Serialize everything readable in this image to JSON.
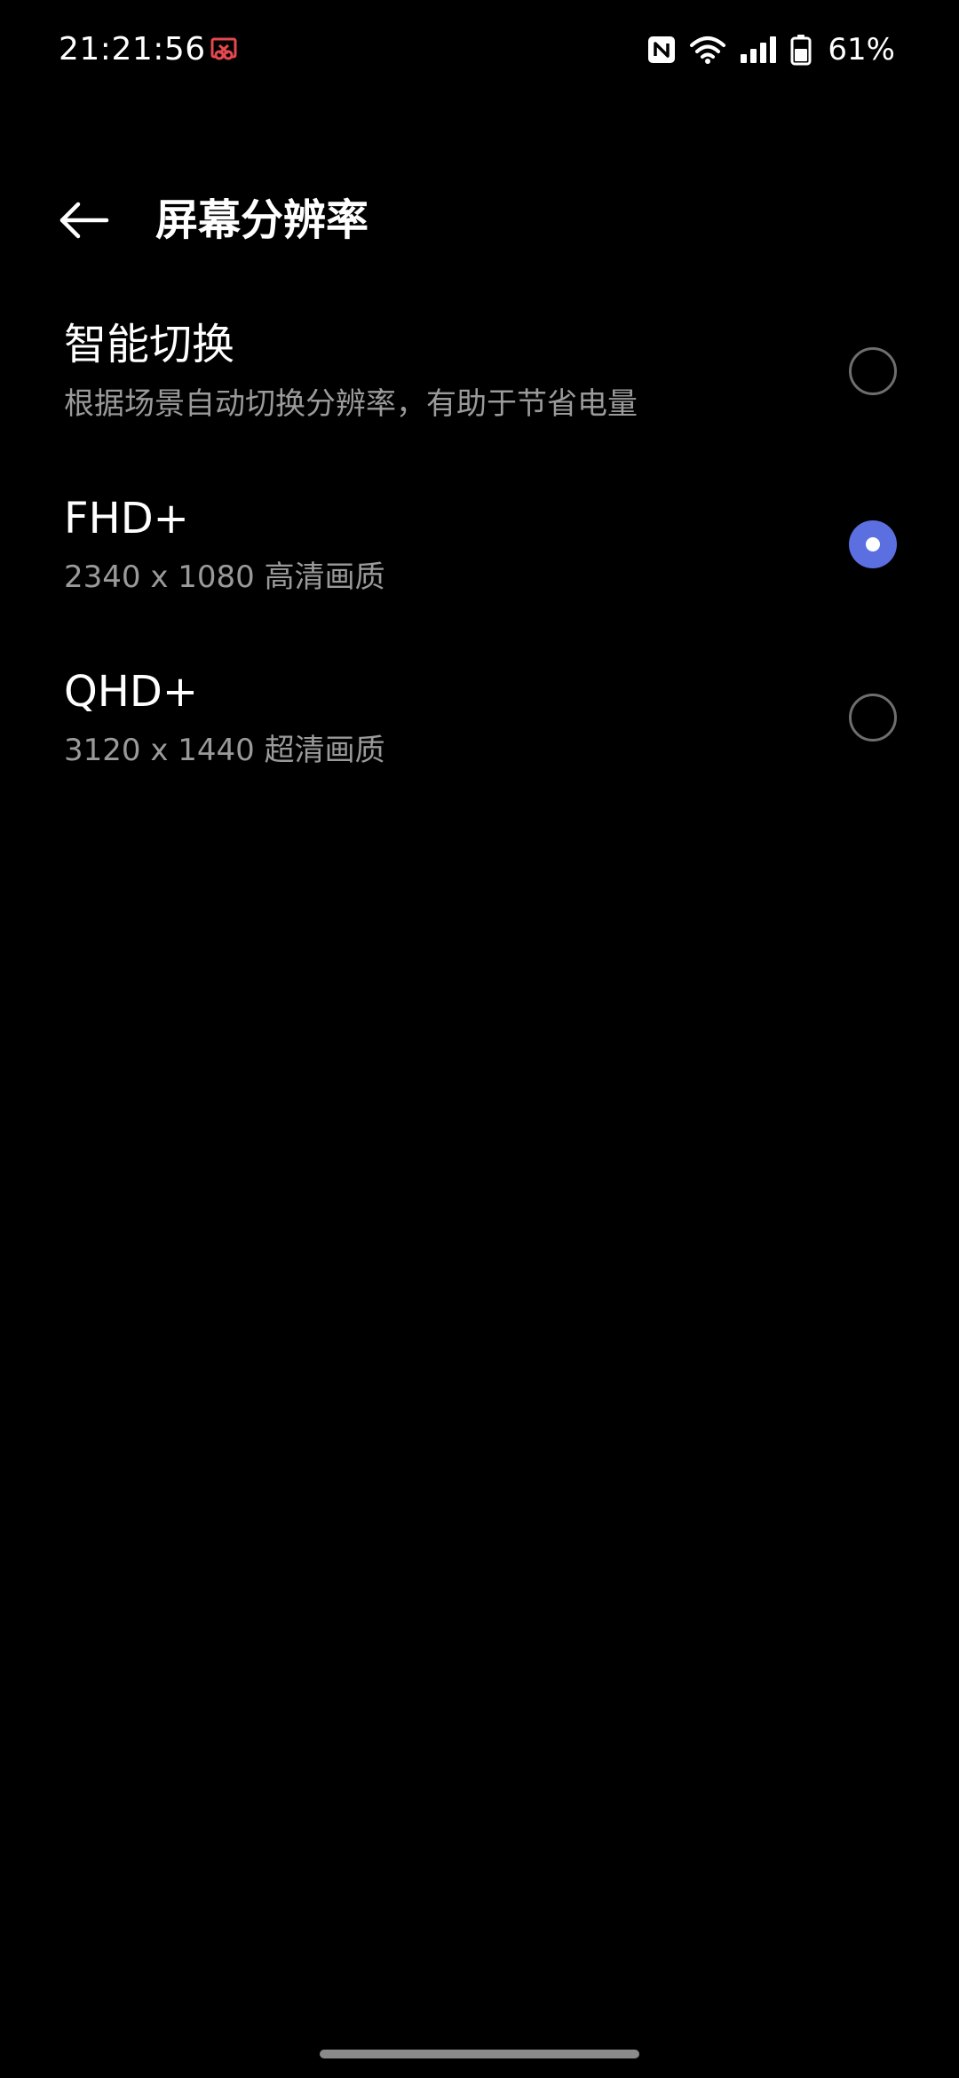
{
  "status_bar": {
    "time": "21:21:56",
    "battery_percent": "61%",
    "battery_level": 0.61,
    "icons": [
      "screen-record-icon",
      "nfc-icon",
      "wifi-icon",
      "cellular-signal-icon",
      "battery-icon"
    ]
  },
  "header": {
    "title": "屏幕分辨率",
    "back_icon": "arrow-left-icon"
  },
  "options": [
    {
      "title": "智能切换",
      "subtitle": "根据场景自动切换分辨率，有助于节省电量",
      "selected": false
    },
    {
      "title": "FHD+",
      "subtitle": "2340 x 1080 高清画质",
      "selected": true
    },
    {
      "title": "QHD+",
      "subtitle": "3120 x 1440 超清画质",
      "selected": false
    }
  ],
  "colors": {
    "background": "#000000",
    "accent": "#5b6fe0",
    "record_indicator": "#e5484d",
    "secondary_text": "#9a9a9a"
  }
}
